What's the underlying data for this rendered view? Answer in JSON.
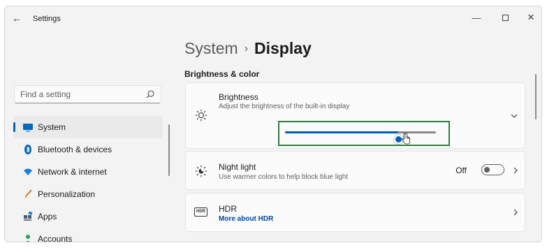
{
  "window": {
    "title": "Settings",
    "controls": {
      "minimize": "—",
      "close": "✕"
    }
  },
  "sidebar": {
    "search_placeholder": "Find a setting",
    "items": [
      {
        "label": "System",
        "icon": "system-icon",
        "selected": true
      },
      {
        "label": "Bluetooth & devices",
        "icon": "bluetooth-icon"
      },
      {
        "label": "Network & internet",
        "icon": "wifi-icon"
      },
      {
        "label": "Personalization",
        "icon": "paintbrush-icon"
      },
      {
        "label": "Apps",
        "icon": "apps-icon"
      },
      {
        "label": "Accounts",
        "icon": "person-icon"
      }
    ]
  },
  "breadcrumb": {
    "parent": "System",
    "separator": "›",
    "current": "Display"
  },
  "section": {
    "title": "Brightness & color"
  },
  "brightness": {
    "title": "Brightness",
    "description": "Adjust the brightness of the built-in display",
    "slider_value_percent": 75
  },
  "night_light": {
    "title": "Night light",
    "description": "Use warmer colors to help block blue light",
    "status": "Off"
  },
  "hdr": {
    "badge": "HDR",
    "title": "HDR",
    "link": "More about HDR"
  },
  "colors": {
    "accent": "#005fb8",
    "highlight_border": "#2f7d3c",
    "window_bg": "#f3f3f3",
    "card_bg": "#fbfbfb"
  }
}
